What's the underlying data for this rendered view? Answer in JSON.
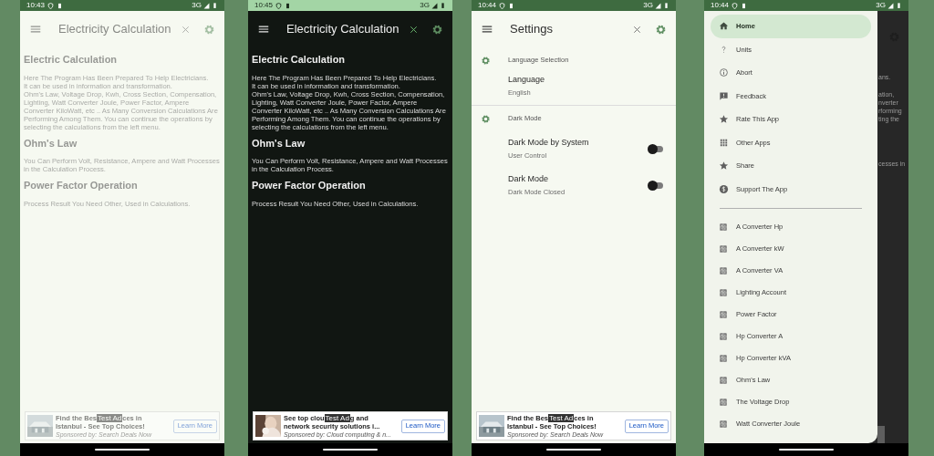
{
  "phones": [
    {
      "kind": "home",
      "dark_mode": false,
      "faded": true,
      "status": {
        "time": "10:43",
        "network": "3G"
      },
      "title": "Electricity Calculation",
      "sections": [
        {
          "heading": "Electric Calculation",
          "body": "Here The Program Has Been Prepared To Help Electricians.\nIt can be used in information and transformation.\nOhm's Law, Voltage Drop, Kwh, Cross Section, Compensation, Lighting, Watt Converter Joule, Power Factor, Ampere Converter KiloWatt, etc .. As Many Conversion Calculations Are Performing Among Them. You can continue the operations by selecting the calculations from the left menu."
        },
        {
          "heading": "Ohm's Law",
          "body": "You Can Perform Volt, Resistance, Ampere and Watt Processes in the Calculation Process."
        },
        {
          "heading": "Power Factor Operation",
          "body": "Process Result You Need Other, Used in Calculations."
        }
      ],
      "ad": {
        "headline_start": "Find the Bes",
        "badge": "Test Ad",
        "headline_end": "ces in",
        "line2": "Istanbul - See Top Choices!",
        "sponsor": "Sponsored by: Search Deals Now",
        "button": "Learn More"
      }
    },
    {
      "kind": "home",
      "dark_mode": true,
      "faded": false,
      "status": {
        "time": "10:45",
        "network": "3G"
      },
      "title": "Electricity Calculation",
      "sections": [
        {
          "heading": "Electric Calculation",
          "body": "Here The Program Has Been Prepared To Help Electricians.\nIt can be used in information and transformation.\nOhm's Law, Voltage Drop, Kwh, Cross Section, Compensation, Lighting, Watt Converter Joule, Power Factor, Ampere Converter KiloWatt, etc .. As Many Conversion Calculations Are Performing Among Them. You can continue the operations by selecting the calculations from the left menu."
        },
        {
          "heading": "Ohm's Law",
          "body": "You Can Perform Volt, Resistance, Ampere and Watt Processes in the Calculation Process."
        },
        {
          "heading": "Power Factor Operation",
          "body": "Process Result You Need Other, Used in Calculations."
        }
      ],
      "ad": {
        "headline_start": "See top clou",
        "badge": "Test Ad",
        "headline_end": "g and",
        "line2": "network security solutions i...",
        "sponsor": "Sponsored by: Cloud computing & n...",
        "button": "Learn More"
      }
    },
    {
      "kind": "settings",
      "dark_mode": false,
      "faded": false,
      "status": {
        "time": "10:44",
        "network": "3G"
      },
      "title": "Settings",
      "groups": [
        {
          "header": "Language Selection",
          "items": [
            {
              "title": "Language",
              "subtitle": "English"
            }
          ]
        },
        {
          "header": "Dark Mode",
          "items": [
            {
              "title": "Dark Mode by System",
              "subtitle": "User Control",
              "switch_on": false
            },
            {
              "title": "Dark Mode",
              "subtitle": "Dark Mode Closed",
              "switch_on": false
            }
          ]
        }
      ],
      "ad": {
        "headline_start": "Find the Bes",
        "badge": "Test Ad",
        "headline_end": "ces in",
        "line2": "Istanbul - See Top Choices!",
        "sponsor": "Sponsored by: Search Deals Now",
        "button": "Learn More"
      }
    },
    {
      "kind": "drawer",
      "dark_mode": false,
      "faded": false,
      "status": {
        "time": "10:44",
        "network": "3G"
      },
      "behind_fragments": [
        "ans.",
        "ation,",
        "nverter",
        "rforming",
        "ting the",
        "cesses in"
      ],
      "menu": [
        {
          "label": "Home",
          "selected": true
        },
        {
          "label": "Units",
          "selected": false
        },
        {
          "label": "Abort",
          "selected": false
        },
        {
          "label": "Feedback",
          "selected": false
        },
        {
          "label": "Rate This App",
          "selected": false
        },
        {
          "label": "Other Apps",
          "selected": false
        },
        {
          "label": "Share",
          "selected": false
        },
        {
          "label": "Support The App",
          "selected": false
        }
      ],
      "tools": [
        {
          "label": "A Converter Hp"
        },
        {
          "label": "A Converter kW"
        },
        {
          "label": "A Converter VA"
        },
        {
          "label": "Lighting Account"
        },
        {
          "label": "Power Factor"
        },
        {
          "label": "Hp Converter A"
        },
        {
          "label": "Hp Converter kVA"
        },
        {
          "label": "Ohm's Law"
        },
        {
          "label": "The Voltage Drop"
        },
        {
          "label": "Watt Converter Joule"
        }
      ]
    }
  ]
}
